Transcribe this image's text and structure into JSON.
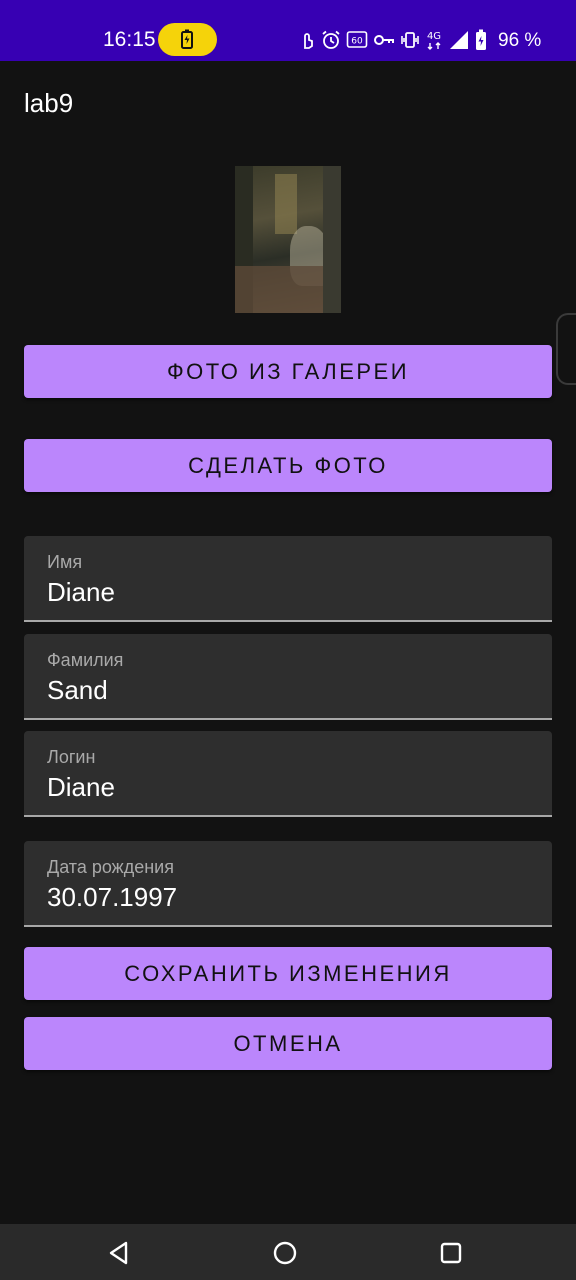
{
  "status_bar": {
    "time": "16:15",
    "battery_percent": "96 %",
    "icons": [
      "battery-charging-icon",
      "touch-icon",
      "alarm-icon",
      "60hz-icon",
      "key-icon",
      "vibrate-icon",
      "4g-icon",
      "signal-icon",
      "battery-icon"
    ],
    "network_label": "4G",
    "refresh_label": "60"
  },
  "app": {
    "title": "lab9"
  },
  "photo": {
    "label": "profile photo"
  },
  "buttons": {
    "gallery": "ФОТО ИЗ ГАЛЕРЕИ",
    "camera": "СДЕЛАТЬ ФОТО",
    "save": "СОХРАНИТЬ ИЗМЕНЕНИЯ",
    "cancel": "ОТМЕНА"
  },
  "fields": {
    "first_name": {
      "label": "Имя",
      "value": "Diane"
    },
    "last_name": {
      "label": "Фамилия",
      "value": "Sand"
    },
    "login": {
      "label": "Логин",
      "value": "Diane"
    },
    "birth_date": {
      "label": "Дата рождения",
      "value": "30.07.1997"
    }
  },
  "nav_bar": {
    "icons": [
      "back-icon",
      "home-icon",
      "recents-icon"
    ]
  },
  "colors": {
    "status_bar": "#3700b3",
    "accent": "#bb86fc",
    "background": "#121212",
    "field_bg": "#2e2e2e",
    "charge_pill": "#f5d30a"
  }
}
